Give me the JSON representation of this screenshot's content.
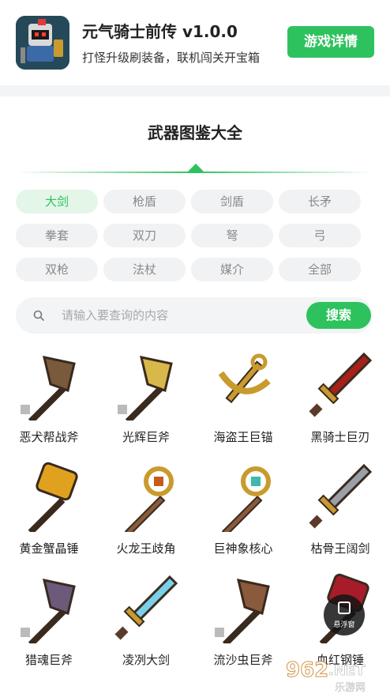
{
  "app": {
    "title": "元气骑士前传 v1.0.0",
    "subtitle": "打怪升级刷装备，联机闯关开宝箱",
    "detail_button": "游戏详情"
  },
  "section": {
    "title": "武器图鉴大全"
  },
  "categories": [
    {
      "label": "大剑",
      "active": true
    },
    {
      "label": "枪盾",
      "active": false
    },
    {
      "label": "剑盾",
      "active": false
    },
    {
      "label": "长矛",
      "active": false
    },
    {
      "label": "拳套",
      "active": false
    },
    {
      "label": "双刀",
      "active": false
    },
    {
      "label": "弩",
      "active": false
    },
    {
      "label": "弓",
      "active": false
    },
    {
      "label": "双枪",
      "active": false
    },
    {
      "label": "法杖",
      "active": false
    },
    {
      "label": "媒介",
      "active": false
    },
    {
      "label": "全部",
      "active": false
    }
  ],
  "search": {
    "placeholder": "请输入要查询的内容",
    "value": "",
    "button": "搜索"
  },
  "weapons": [
    {
      "name": "恶犬帮战斧",
      "icon": "axe-icon",
      "color": "#7a5a3c"
    },
    {
      "name": "光辉巨斧",
      "icon": "axe-icon",
      "color": "#d8b84a"
    },
    {
      "name": "海盗王巨锚",
      "icon": "anchor-icon",
      "color": "#c99a2e"
    },
    {
      "name": "黑骑士巨刃",
      "icon": "sword-icon",
      "color": "#a8201a"
    },
    {
      "name": "黄金蟹晶锤",
      "icon": "hammer-icon",
      "color": "#e0a21e"
    },
    {
      "name": "火龙王歧角",
      "icon": "staff-icon",
      "color": "#c85a1e"
    },
    {
      "name": "巨神象核心",
      "icon": "staff-icon",
      "color": "#3fb8b0"
    },
    {
      "name": "枯骨王阔剑",
      "icon": "sword-icon",
      "color": "#9aa0a8"
    },
    {
      "name": "猎魂巨斧",
      "icon": "axe-icon",
      "color": "#6b5a7a"
    },
    {
      "name": "凌冽大剑",
      "icon": "sword-icon",
      "color": "#7ad0e8"
    },
    {
      "name": "流沙虫巨斧",
      "icon": "axe-icon",
      "color": "#8a5a3c"
    },
    {
      "name": "血红钢锤",
      "icon": "hammer-icon",
      "color": "#a81c2a"
    }
  ],
  "float_window": {
    "label": "悬浮窗"
  },
  "watermark": {
    "text": "962.NET",
    "sub": "乐游网"
  },
  "colors": {
    "accent": "#2ec25e",
    "chip_bg": "#f1f2f4"
  }
}
